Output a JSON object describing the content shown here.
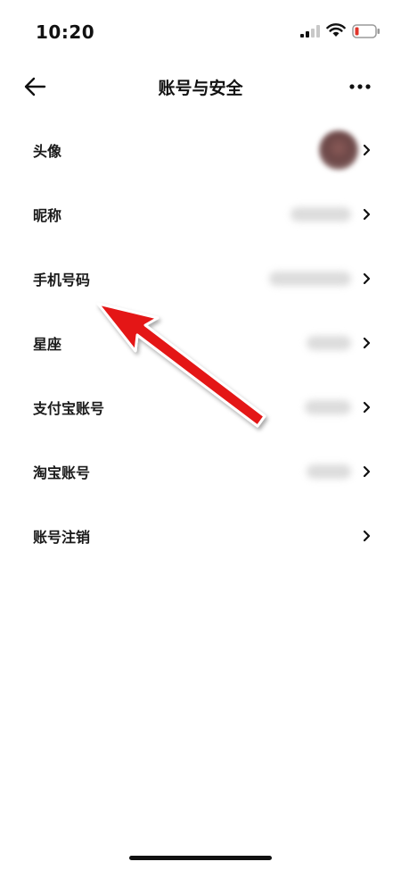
{
  "status_bar": {
    "time": "10:20",
    "icons": [
      "signal-icon",
      "wifi-icon",
      "battery-low-icon"
    ],
    "battery_color": "#e0352b"
  },
  "header": {
    "title": "账号与安全",
    "back_icon": "arrow-left-icon",
    "more_icon": "more-horizontal-icon"
  },
  "settings": {
    "items": [
      {
        "label": "头像",
        "value_type": "avatar"
      },
      {
        "label": "昵称",
        "value_type": "blurred"
      },
      {
        "label": "手机号码",
        "value_type": "blurred"
      },
      {
        "label": "星座",
        "value_type": "blurred"
      },
      {
        "label": "支付宝账号",
        "value_type": "blurred"
      },
      {
        "label": "淘宝账号",
        "value_type": "blurred"
      },
      {
        "label": "账号注销",
        "value_type": "none"
      }
    ]
  },
  "annotation": {
    "icon": "red-arrow-icon",
    "color": "#e41414",
    "points_to": "手机号码"
  }
}
